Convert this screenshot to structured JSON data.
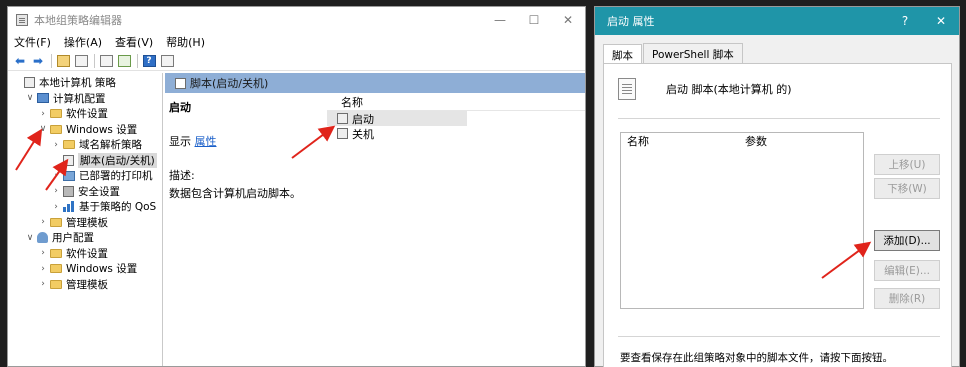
{
  "gpe": {
    "title": "本地组策略编辑器",
    "menu": [
      "文件(F)",
      "操作(A)",
      "查看(V)",
      "帮助(H)"
    ],
    "tree": [
      {
        "label": "本地计算机 策略",
        "indent": 0,
        "chev": "",
        "icon": "box"
      },
      {
        "label": "计算机配置",
        "indent": 1,
        "chev": "∨",
        "icon": "computer"
      },
      {
        "label": "软件设置",
        "indent": 2,
        "chev": "›",
        "icon": "folder"
      },
      {
        "label": "Windows 设置",
        "indent": 2,
        "chev": "∨",
        "icon": "folder"
      },
      {
        "label": "域名解析策略",
        "indent": 3,
        "chev": "›",
        "icon": "folder"
      },
      {
        "label": "脚本(启动/关机)",
        "indent": 3,
        "chev": "",
        "icon": "box",
        "selected": true
      },
      {
        "label": "已部署的打印机",
        "indent": 3,
        "chev": "›",
        "icon": "printer"
      },
      {
        "label": "安全设置",
        "indent": 3,
        "chev": "›",
        "icon": "lock"
      },
      {
        "label": "基于策略的 QoS",
        "indent": 3,
        "chev": "›",
        "icon": "chart"
      },
      {
        "label": "管理模板",
        "indent": 2,
        "chev": "›",
        "icon": "folder"
      },
      {
        "label": "用户配置",
        "indent": 1,
        "chev": "∨",
        "icon": "user"
      },
      {
        "label": "软件设置",
        "indent": 2,
        "chev": "›",
        "icon": "folder"
      },
      {
        "label": "Windows 设置",
        "indent": 2,
        "chev": "›",
        "icon": "folder"
      },
      {
        "label": "管理模板",
        "indent": 2,
        "chev": "›",
        "icon": "folder"
      }
    ],
    "content": {
      "header": "脚本(启动/关机)",
      "title": "启动",
      "show_prefix": "显示",
      "show_link": "属性",
      "desc_label": "描述:",
      "desc_text": "数据包含计算机启动脚本。",
      "list_header": "名称",
      "items": [
        "启动",
        "关机"
      ]
    }
  },
  "dlg": {
    "title": "启动 属性",
    "help": "?",
    "close": "✕",
    "tabs": [
      "脚本",
      "PowerShell 脚本"
    ],
    "heading": "启动 脚本(本地计算机 的)",
    "col_name": "名称",
    "col_params": "参数",
    "buttons": {
      "up": "上移(U)",
      "down": "下移(W)",
      "add": "添加(D)...",
      "edit": "编辑(E)...",
      "remove": "删除(R)"
    },
    "footer": "要查看保存在此组策略对象中的脚本文件，请按下面按钮。"
  },
  "colors": {
    "dialog_title_bar": "#1f95a8",
    "content_header": "#8eaed6",
    "annotation": "#e0241b",
    "link": "#1a5fc9"
  }
}
